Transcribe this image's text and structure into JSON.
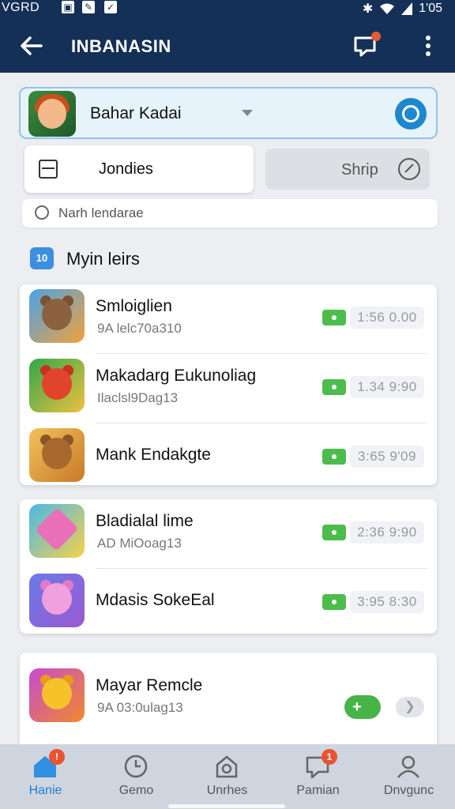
{
  "status_bar": {
    "carrier": "VGRD",
    "time": "1'05"
  },
  "app_bar": {
    "title": "INBANASIN"
  },
  "account": {
    "name": "Bahar Kadai"
  },
  "actions": {
    "primary_label": "Jondies",
    "secondary_label": "Shrip"
  },
  "hint": {
    "text": "Narh lendarae"
  },
  "section": {
    "badge": "10",
    "title": "Myin leirs"
  },
  "groups": [
    {
      "items": [
        {
          "title": "Smloiglien",
          "subtitle": "9A lelc70a310",
          "time": "1:56 0.00"
        },
        {
          "title": "Makadarg Eukunoliag",
          "subtitle": "Ilaclsl9Dag13",
          "time": "1.34 9:90"
        },
        {
          "title": "Mank Endakgte",
          "subtitle": "",
          "time": "3:65 9'09"
        }
      ]
    },
    {
      "items": [
        {
          "title": "Bladialal lime",
          "subtitle": "AD MiOoag13",
          "time": "2:36 9:90"
        },
        {
          "title": "Mdasis SokeEal",
          "subtitle": "",
          "time": "3:95 8:30"
        }
      ]
    },
    {
      "items": [
        {
          "title": "Mayar Remcle",
          "subtitle": "9A 03:0ulag13",
          "toggle_label": "+"
        }
      ]
    }
  ],
  "bottom_nav": [
    {
      "label": "Hanie",
      "badge": "!"
    },
    {
      "label": "Gemo"
    },
    {
      "label": "Unrhes"
    },
    {
      "label": "Pamian",
      "badge": "1"
    },
    {
      "label": "Dnvgunc"
    }
  ],
  "colors": {
    "appbar": "#143056",
    "accent": "#1f87cf",
    "toggle": "#4cbd4c",
    "badge": "#e8542f"
  }
}
